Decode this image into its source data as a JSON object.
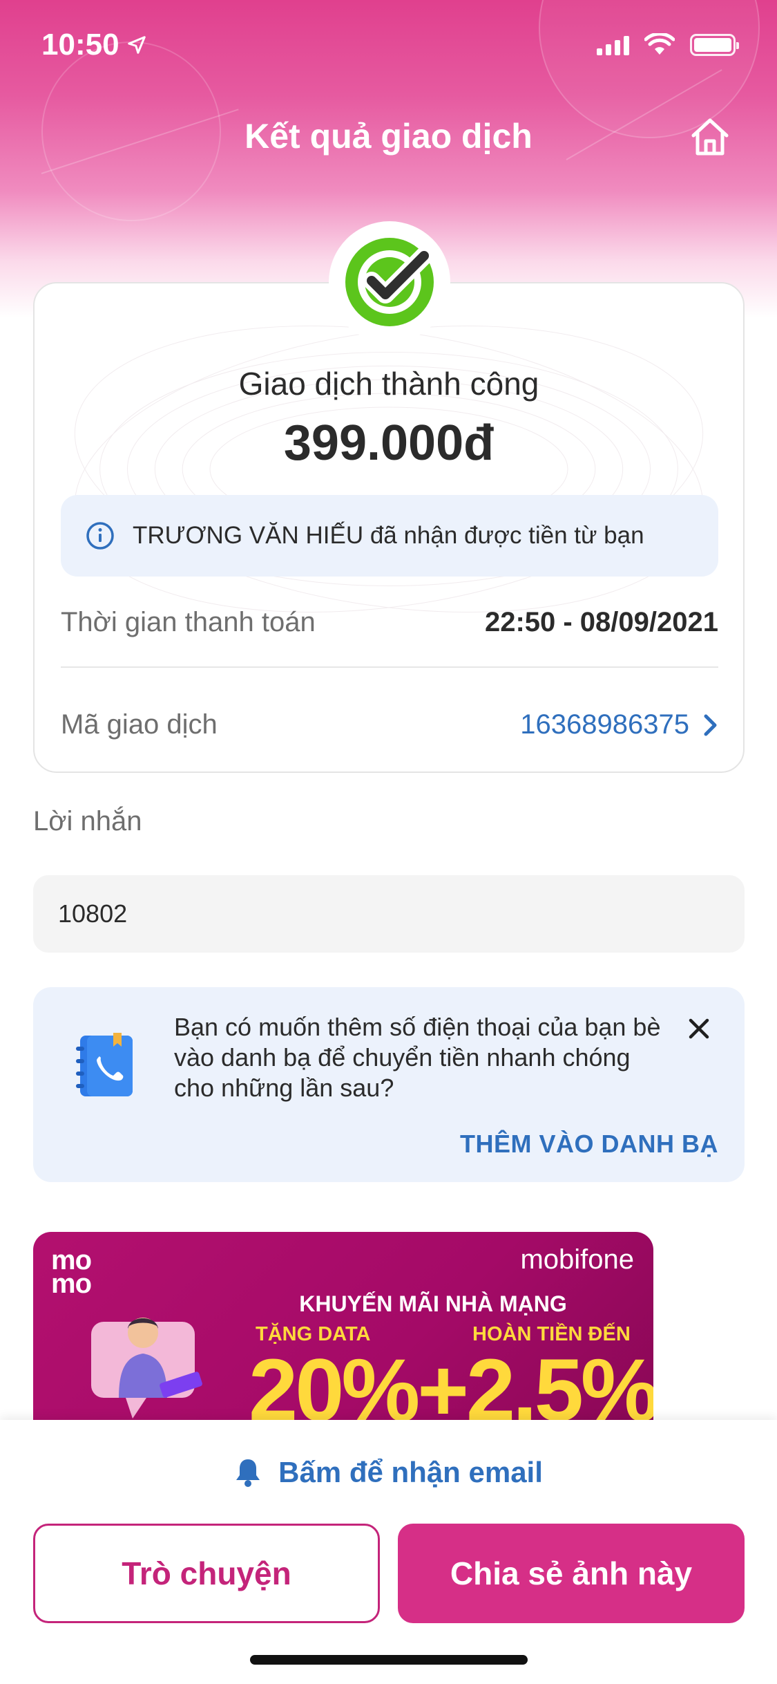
{
  "status_bar": {
    "time": "10:50"
  },
  "nav": {
    "title": "Kết quả giao dịch"
  },
  "result": {
    "title": "Giao dịch thành công",
    "amount": "399.000đ",
    "info": "TRƯƠNG VĂN HIẾU đã nhận được tiền từ bạn",
    "payment_time_label": "Thời gian thanh toán",
    "payment_time_value": "22:50 - 08/09/2021",
    "transaction_id_label": "Mã giao dịch",
    "transaction_id_value": "16368986375"
  },
  "message": {
    "label": "Lời nhắn",
    "value": "10802"
  },
  "contact_prompt": {
    "text": "Bạn có muốn thêm số điện thoại của bạn bè vào danh bạ để chuyển tiền nhanh chóng cho những lần sau?",
    "action": "THÊM VÀO DANH BẠ"
  },
  "promo": {
    "logo_line1": "mo",
    "logo_line2": "mo",
    "brand": "mobifone",
    "heading": "KHUYẾN MÃI NHÀ MẠNG",
    "sub_left": "TẶNG DATA",
    "sub_right": "HOÀN TIỀN ĐẾN",
    "big_text": "20%+2.5%"
  },
  "bottom": {
    "email_link": "Bấm để nhận email",
    "chat_button": "Trò chuyện",
    "share_button": "Chia sẻ ảnh này"
  },
  "colors": {
    "brand_pink": "#d62f87",
    "success_green": "#5cc51c",
    "link_blue": "#2f6fbd",
    "info_bg": "#ecf2fc"
  },
  "icons": {
    "status": [
      "location-arrow-icon",
      "signal-icon",
      "wifi-icon",
      "battery-icon"
    ],
    "nav": "home-icon",
    "result": "check-circle-icon",
    "info": "info-icon",
    "transaction": "chevron-right-icon",
    "contact": "phonebook-icon",
    "close": "close-icon",
    "email": "bell-icon"
  }
}
